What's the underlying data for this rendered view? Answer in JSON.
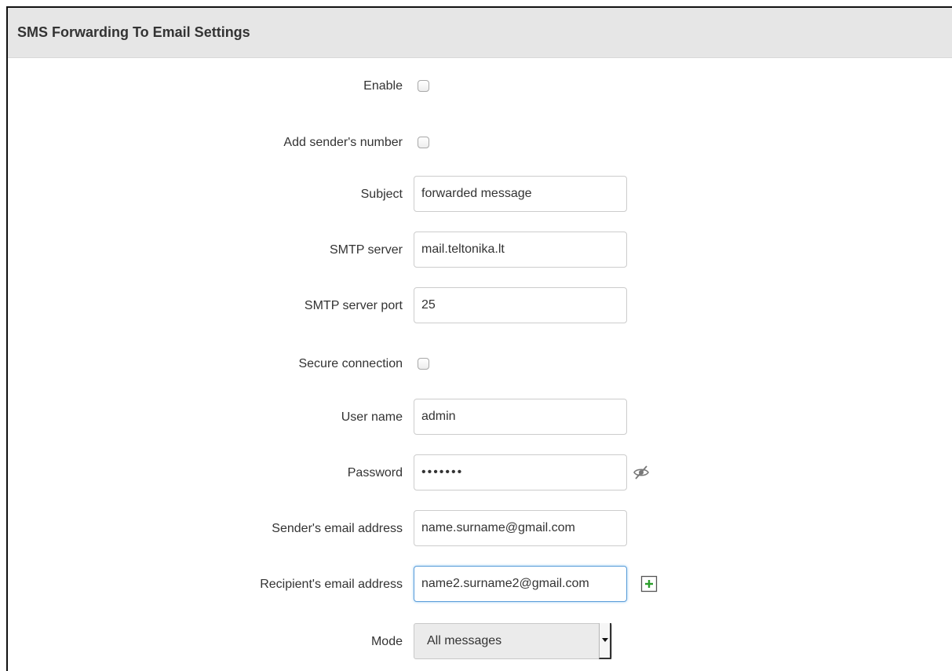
{
  "panel": {
    "title": "SMS Forwarding To Email Settings"
  },
  "fields": {
    "enable": {
      "label": "Enable",
      "checked": false
    },
    "add_sender_number": {
      "label": "Add sender's number",
      "checked": false
    },
    "subject": {
      "label": "Subject",
      "value": "forwarded message"
    },
    "smtp_server": {
      "label": "SMTP server",
      "value": "mail.teltonika.lt"
    },
    "smtp_port": {
      "label": "SMTP server port",
      "value": "25"
    },
    "secure_connection": {
      "label": "Secure connection",
      "checked": false
    },
    "user_name": {
      "label": "User name",
      "value": "admin"
    },
    "password": {
      "label": "Password",
      "value": "•••••••",
      "toggle_icon": "eye-slash-icon"
    },
    "sender_email": {
      "label": "Sender's email address",
      "value": "name.surname@gmail.com"
    },
    "recipient_email": {
      "label": "Recipient's email address",
      "value": "name2.surname2@gmail.com",
      "add_icon": "plus-icon"
    },
    "mode": {
      "label": "Mode",
      "selected": "All messages"
    }
  },
  "colors": {
    "header_bg": "#e6e6e6",
    "focus_border": "#5b9dd9",
    "add_icon_green": "#2a9d2a"
  }
}
